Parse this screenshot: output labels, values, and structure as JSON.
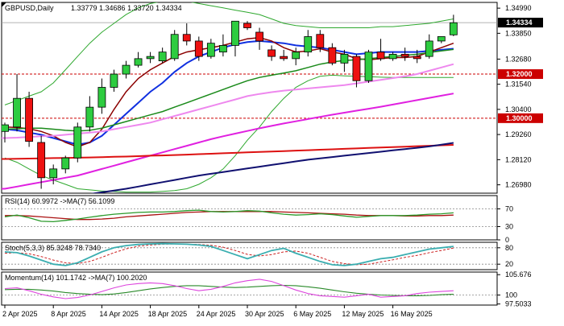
{
  "header": {
    "symbol": "GBPUSD,Daily",
    "ohlc": "1.33779 1.34686 1.33720 1.34334"
  },
  "colors": {
    "bull": "#2ecc40",
    "bear": "#ee1111",
    "ma_fast_blue": "#1030e0",
    "ma_maroon": "#8b0000",
    "ma_green": "#1a8a1a",
    "bollinger": "#2ea82e",
    "ma_violet": "#ee88ee",
    "ma_magenta": "#e020e0",
    "ma_red": "#dd1111",
    "ma_navy": "#101070",
    "level_line": "#cc0000",
    "oscillator_main": "#3aaeb0",
    "oscillator_signal": "#cc2222",
    "rsi_main": "#2a9a2a",
    "rsi_signal": "#aa1111",
    "momentum_main": "#dd44dd",
    "momentum_signal": "#2a8a2a",
    "price_tag_bg": "#000000",
    "level_tag_bg": "#cc0000"
  },
  "chart_data": [
    {
      "type": "candlestick",
      "title": "GBPUSD,Daily",
      "ylim": [
        1.266,
        1.3525
      ],
      "y_ticks": [
        "1.34990",
        "1.33850",
        "1.32680",
        "1.31540",
        "1.30400",
        "1.29260",
        "1.28120",
        "1.26980"
      ],
      "x_ticks": [
        "2 Apr 2025",
        "8 Apr 2025",
        "14 Apr 2025",
        "18 Apr 2025",
        "24 Apr 2025",
        "30 Apr 2025",
        "6 May 2025",
        "12 May 2025",
        "16 May 2025"
      ],
      "current_price": "1.34334",
      "levels": [
        {
          "label": "1.32000",
          "value": 1.32
        },
        {
          "label": "1.30000",
          "value": 1.3
        }
      ],
      "candles": [
        {
          "o": 1.294,
          "h": 1.298,
          "l": 1.289,
          "c": 1.297
        },
        {
          "o": 1.296,
          "h": 1.32,
          "l": 1.294,
          "c": 1.309
        },
        {
          "o": 1.309,
          "h": 1.312,
          "l": 1.287,
          "c": 1.2895
        },
        {
          "o": 1.289,
          "h": 1.292,
          "l": 1.268,
          "c": 1.273
        },
        {
          "o": 1.273,
          "h": 1.279,
          "l": 1.27,
          "c": 1.277
        },
        {
          "o": 1.277,
          "h": 1.283,
          "l": 1.275,
          "c": 1.282
        },
        {
          "o": 1.282,
          "h": 1.298,
          "l": 1.28,
          "c": 1.296
        },
        {
          "o": 1.296,
          "h": 1.31,
          "l": 1.294,
          "c": 1.305
        },
        {
          "o": 1.305,
          "h": 1.318,
          "l": 1.302,
          "c": 1.314
        },
        {
          "o": 1.314,
          "h": 1.322,
          "l": 1.312,
          "c": 1.32
        },
        {
          "o": 1.32,
          "h": 1.326,
          "l": 1.318,
          "c": 1.324
        },
        {
          "o": 1.324,
          "h": 1.33,
          "l": 1.323,
          "c": 1.327
        },
        {
          "o": 1.327,
          "h": 1.33,
          "l": 1.325,
          "c": 1.328
        },
        {
          "o": 1.326,
          "h": 1.332,
          "l": 1.325,
          "c": 1.33
        },
        {
          "o": 1.327,
          "h": 1.34,
          "l": 1.326,
          "c": 1.338
        },
        {
          "o": 1.338,
          "h": 1.343,
          "l": 1.333,
          "c": 1.335
        },
        {
          "o": 1.335,
          "h": 1.337,
          "l": 1.326,
          "c": 1.328
        },
        {
          "o": 1.328,
          "h": 1.336,
          "l": 1.327,
          "c": 1.334
        },
        {
          "o": 1.33,
          "h": 1.338,
          "l": 1.328,
          "c": 1.333
        },
        {
          "o": 1.333,
          "h": 1.344,
          "l": 1.328,
          "c": 1.344
        },
        {
          "o": 1.343,
          "h": 1.344,
          "l": 1.34,
          "c": 1.341
        },
        {
          "o": 1.339,
          "h": 1.341,
          "l": 1.331,
          "c": 1.335
        },
        {
          "o": 1.331,
          "h": 1.333,
          "l": 1.326,
          "c": 1.328
        },
        {
          "o": 1.328,
          "h": 1.331,
          "l": 1.326,
          "c": 1.327
        },
        {
          "o": 1.327,
          "h": 1.332,
          "l": 1.324,
          "c": 1.33
        },
        {
          "o": 1.33,
          "h": 1.34,
          "l": 1.328,
          "c": 1.337
        },
        {
          "o": 1.338,
          "h": 1.34,
          "l": 1.33,
          "c": 1.332
        },
        {
          "o": 1.332,
          "h": 1.334,
          "l": 1.324,
          "c": 1.325
        },
        {
          "o": 1.325,
          "h": 1.331,
          "l": 1.321,
          "c": 1.329
        },
        {
          "o": 1.328,
          "h": 1.329,
          "l": 1.314,
          "c": 1.317
        },
        {
          "o": 1.317,
          "h": 1.331,
          "l": 1.316,
          "c": 1.33
        },
        {
          "o": 1.33,
          "h": 1.336,
          "l": 1.326,
          "c": 1.327
        },
        {
          "o": 1.327,
          "h": 1.33,
          "l": 1.326,
          "c": 1.329
        },
        {
          "o": 1.329,
          "h": 1.332,
          "l": 1.326,
          "c": 1.328
        },
        {
          "o": 1.328,
          "h": 1.331,
          "l": 1.325,
          "c": 1.327
        },
        {
          "o": 1.328,
          "h": 1.338,
          "l": 1.327,
          "c": 1.335
        },
        {
          "o": 1.335,
          "h": 1.337,
          "l": 1.334,
          "c": 1.337
        },
        {
          "o": 1.3378,
          "h": 1.3469,
          "l": 1.3372,
          "c": 1.3433
        }
      ],
      "series": [
        {
          "name": "ma_fast",
          "color": "#1030e0",
          "width": 2,
          "values": [
            1.295,
            1.2945,
            1.2935,
            1.2925,
            1.291,
            1.2895,
            1.288,
            1.289,
            1.292,
            1.297,
            1.302,
            1.307,
            1.312,
            1.316,
            1.321,
            1.325,
            1.328,
            1.33,
            1.332,
            1.3335,
            1.3345,
            1.335,
            1.3345,
            1.334,
            1.333,
            1.3325,
            1.332,
            1.331,
            1.33,
            1.329,
            1.3295,
            1.33,
            1.33,
            1.33,
            1.33,
            1.3305,
            1.331,
            1.3315
          ]
        },
        {
          "name": "ma_slow",
          "color": "#8b0000",
          "width": 1.5,
          "values": [
            1.296,
            1.2958,
            1.2952,
            1.294,
            1.292,
            1.289,
            1.287,
            1.289,
            1.295,
            1.304,
            1.312,
            1.318,
            1.322,
            1.325,
            1.328,
            1.33,
            1.331,
            1.332,
            1.333,
            1.3345,
            1.336,
            1.3365,
            1.335,
            1.332,
            1.33,
            1.3305,
            1.3315,
            1.33,
            1.329,
            1.327,
            1.3265,
            1.327,
            1.3275,
            1.3275,
            1.328,
            1.33,
            1.332,
            1.334
          ]
        },
        {
          "name": "ma_green",
          "color": "#1a8a1a",
          "width": 1.5,
          "values": [
            1.295,
            1.2952,
            1.2955,
            1.2955,
            1.295,
            1.2945,
            1.2942,
            1.2945,
            1.2955,
            1.297,
            1.2985,
            1.3,
            1.3015,
            1.303,
            1.305,
            1.307,
            1.309,
            1.311,
            1.313,
            1.315,
            1.317,
            1.3185,
            1.3195,
            1.3205,
            1.3215,
            1.323,
            1.3245,
            1.3255,
            1.3262,
            1.3265,
            1.327,
            1.3275,
            1.328,
            1.3285,
            1.329,
            1.3298,
            1.3305,
            1.3312
          ]
        },
        {
          "name": "bb_upper",
          "color": "#2ea82e",
          "width": 1,
          "values": [
            1.306,
            1.308,
            1.31,
            1.312,
            1.316,
            1.322,
            1.328,
            1.334,
            1.339,
            1.343,
            1.347,
            1.35,
            1.352,
            1.353,
            1.3535,
            1.353,
            1.352,
            1.351,
            1.35,
            1.349,
            1.348,
            1.347,
            1.345,
            1.343,
            1.342,
            1.3415,
            1.341,
            1.341,
            1.341,
            1.341,
            1.341,
            1.3415,
            1.3415,
            1.342,
            1.3425,
            1.343,
            1.344,
            1.345
          ]
        },
        {
          "name": "bb_lower",
          "color": "#2ea82e",
          "width": 1,
          "values": [
            1.282,
            1.28,
            1.277,
            1.274,
            1.272,
            1.27,
            1.268,
            1.2675,
            1.267,
            1.2668,
            1.2665,
            1.2665,
            1.2665,
            1.2668,
            1.2672,
            1.268,
            1.27,
            1.273,
            1.277,
            1.283,
            1.29,
            1.296,
            1.303,
            1.309,
            1.314,
            1.317,
            1.319,
            1.3195,
            1.3192,
            1.319,
            1.3188,
            1.3186,
            1.3185,
            1.3185,
            1.3185,
            1.3185,
            1.3185,
            1.3185
          ]
        },
        {
          "name": "ma_violet",
          "color": "#ee88ee",
          "width": 2,
          "values": [
            1.291,
            1.2912,
            1.2915,
            1.2918,
            1.292,
            1.2925,
            1.293,
            1.2935,
            1.294,
            1.295,
            1.296,
            1.297,
            1.298,
            1.2995,
            1.301,
            1.3025,
            1.304,
            1.3055,
            1.307,
            1.3085,
            1.31,
            1.311,
            1.3118,
            1.3125,
            1.313,
            1.3135,
            1.314,
            1.3145,
            1.315,
            1.3158,
            1.3166,
            1.3174,
            1.3182,
            1.319,
            1.32,
            1.3215,
            1.323,
            1.3245
          ]
        },
        {
          "name": "ma_magenta",
          "color": "#e020e0",
          "width": 2,
          "values": [
            1.268,
            1.269,
            1.27,
            1.271,
            1.272,
            1.273,
            1.274,
            1.2755,
            1.277,
            1.2785,
            1.28,
            1.2815,
            1.283,
            1.2845,
            1.286,
            1.2875,
            1.289,
            1.2905,
            1.2918,
            1.293,
            1.2942,
            1.2954,
            1.2965,
            1.2976,
            1.2986,
            1.2996,
            1.3006,
            1.3016,
            1.3025,
            1.3034,
            1.3043,
            1.3052,
            1.3062,
            1.3072,
            1.3082,
            1.3092,
            1.3102,
            1.3112
          ]
        },
        {
          "name": "ma_red",
          "color": "#dd1111",
          "width": 2,
          "values": [
            1.2815,
            1.2816,
            1.2817,
            1.2818,
            1.2819,
            1.282,
            1.2821,
            1.2822,
            1.2823,
            1.2825,
            1.2826,
            1.2828,
            1.283,
            1.2831,
            1.2833,
            1.2835,
            1.2837,
            1.2839,
            1.2841,
            1.2843,
            1.2845,
            1.2847,
            1.2849,
            1.2851,
            1.2853,
            1.2855,
            1.2857,
            1.2859,
            1.2861,
            1.2863,
            1.2865,
            1.2867,
            1.2869,
            1.2871,
            1.2873,
            1.2875,
            1.2877,
            1.2879
          ]
        },
        {
          "name": "ma_navy",
          "color": "#101070",
          "width": 2,
          "values": [
            1.26,
            1.2608,
            1.2616,
            1.2624,
            1.2632,
            1.264,
            1.2648,
            1.2656,
            1.2664,
            1.2672,
            1.268,
            1.269,
            1.27,
            1.271,
            1.272,
            1.273,
            1.274,
            1.2748,
            1.2756,
            1.2764,
            1.2772,
            1.278,
            1.2788,
            1.2796,
            1.2804,
            1.2812,
            1.2818,
            1.2824,
            1.283,
            1.2836,
            1.2842,
            1.2848,
            1.2854,
            1.286,
            1.2866,
            1.2872,
            1.288,
            1.2888
          ]
        }
      ]
    },
    {
      "type": "line",
      "title": "RSI(14) 60.9972 ->MA(7) 56.1099",
      "ylim": [
        0,
        100
      ],
      "y_ticks": [
        "70",
        "30",
        "0"
      ],
      "levels": [
        70,
        30
      ],
      "series": [
        {
          "name": "RSI(14)",
          "color": "#2a9a2a",
          "values": [
            52,
            56,
            50,
            42,
            41,
            44,
            47,
            51,
            55,
            58,
            60,
            62,
            63,
            63,
            64,
            66,
            67,
            64,
            63,
            64,
            66,
            65,
            61,
            58,
            56,
            57,
            59,
            57,
            54,
            51,
            53,
            55,
            55,
            55,
            56,
            58,
            59,
            61
          ]
        },
        {
          "name": "MA(7)",
          "color": "#aa1111",
          "values": [
            55,
            55,
            54,
            52,
            50,
            48,
            46,
            46,
            47,
            49,
            52,
            54,
            56,
            58,
            60,
            62,
            63,
            64,
            64,
            64,
            64,
            64,
            64,
            63,
            62,
            61,
            60,
            59,
            58,
            56,
            55,
            55,
            55,
            54,
            54,
            55,
            55,
            56
          ]
        }
      ]
    },
    {
      "type": "line",
      "title": "Stoch(5,3,3) 85.3248 78.7340",
      "ylim": [
        0,
        100
      ],
      "y_ticks": [
        "80",
        "20"
      ],
      "levels": [
        80,
        20
      ],
      "series": [
        {
          "name": "%K",
          "color": "#3aaeb0",
          "values": [
            65,
            62,
            50,
            35,
            20,
            15,
            25,
            45,
            65,
            80,
            88,
            92,
            94,
            95,
            94,
            93,
            90,
            85,
            70,
            55,
            40,
            55,
            70,
            78,
            60,
            45,
            30,
            18,
            15,
            20,
            30,
            40,
            45,
            55,
            65,
            75,
            80,
            85
          ]
        },
        {
          "name": "%D",
          "color": "#cc2222",
          "values": [
            60,
            62,
            58,
            48,
            35,
            25,
            22,
            30,
            45,
            62,
            76,
            86,
            90,
            93,
            94,
            93,
            92,
            89,
            82,
            70,
            56,
            50,
            55,
            65,
            68,
            60,
            45,
            30,
            22,
            18,
            20,
            28,
            36,
            45,
            52,
            62,
            70,
            79
          ]
        }
      ]
    },
    {
      "type": "line",
      "title": "Momentum(14) 101.1742 ->MA(7) 100.2020",
      "ylim": [
        97.2,
        106.4
      ],
      "y_ticks": [
        "105.676",
        "100",
        "97.5033"
      ],
      "levels": [
        100
      ],
      "series": [
        {
          "name": "Momentum(14)",
          "color": "#dd44dd",
          "values": [
            101.8,
            102.0,
            101.2,
            100.2,
            99.5,
            99.0,
            99.3,
            100.0,
            101.0,
            102.0,
            102.8,
            103.2,
            103.4,
            103.2,
            102.6,
            101.8,
            101.2,
            101.6,
            102.4,
            103.4,
            104.0,
            104.4,
            103.8,
            102.6,
            101.4,
            100.4,
            99.8,
            99.6,
            99.4,
            99.8,
            100.2,
            99.4,
            99.6,
            99.8,
            100.4,
            100.8,
            101.0,
            101.2
          ]
        },
        {
          "name": "MA(7)",
          "color": "#2a8a2a",
          "values": [
            101.5,
            101.6,
            101.6,
            101.4,
            101.1,
            100.7,
            100.4,
            100.2,
            100.1,
            100.3,
            100.7,
            101.2,
            101.7,
            102.1,
            102.4,
            102.6,
            102.6,
            102.4,
            102.2,
            102.1,
            102.2,
            102.4,
            102.6,
            102.7,
            102.6,
            102.3,
            101.9,
            101.4,
            100.9,
            100.5,
            100.2,
            100.0,
            99.9,
            99.8,
            99.8,
            99.9,
            100.1,
            100.2
          ]
        }
      ]
    }
  ]
}
